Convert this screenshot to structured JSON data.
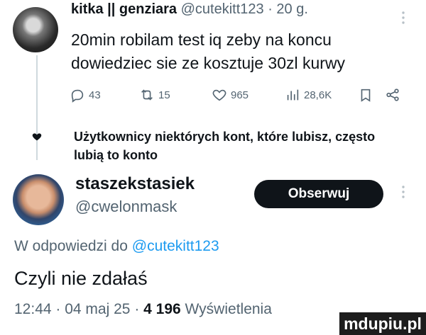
{
  "tweet": {
    "author_name": "kitka || genziara",
    "author_handle": "@cutekitt123",
    "time": "20 g.",
    "text": "20min robilam test iq zeby na koncu dowiedziec sie ze kosztuje 30zl kurwy",
    "stats": {
      "replies": "43",
      "retweets": "15",
      "likes": "965",
      "views": "28,6K"
    }
  },
  "recommendation": {
    "text": "Użytkownicy niektórych kont, które lubisz, często lubią to konto"
  },
  "reply": {
    "author_name": "staszekstasiek",
    "author_handle": "@cwelonmask",
    "follow_label": "Obserwuj",
    "replying_prefix": "W odpowiedzi do",
    "replying_to": "@cutekitt123",
    "text": "Czyli nie zdałaś",
    "time": "12:44",
    "date": "04 maj 25",
    "views_count": "4 196",
    "views_label": "Wyświetlenia"
  },
  "watermark": "mdupiu.pl",
  "colors": {
    "text": "#0f1419",
    "secondary": "#536471",
    "link": "#1d9bf0",
    "button": "#0f1419"
  }
}
